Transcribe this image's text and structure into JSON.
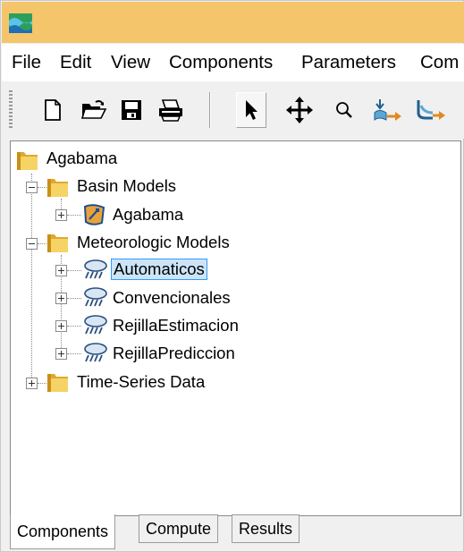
{
  "app": {
    "icon": "hec-hms-app-icon"
  },
  "menu": [
    "File",
    "Edit",
    "View",
    "Components",
    "Parameters",
    "Com"
  ],
  "toolbar": {
    "buttons": [
      {
        "icon": "new-file-icon"
      },
      {
        "icon": "open-folder-icon"
      },
      {
        "icon": "save-icon"
      },
      {
        "icon": "print-icon"
      },
      {
        "icon": "pointer-arrow-icon",
        "active": true
      },
      {
        "icon": "move-arrows-icon"
      },
      {
        "icon": "zoom-magnifier-icon"
      },
      {
        "icon": "add-subbasin-icon"
      },
      {
        "icon": "add-reach-icon"
      }
    ]
  },
  "tree": {
    "root": "Agabama",
    "basin_models": "Basin Models",
    "basin_child": "Agabama",
    "meteorologic_models": "Meteorologic Models",
    "met_children": [
      "Automaticos",
      "Convencionales",
      "RejillaEstimacion",
      "RejillaPrediccion"
    ],
    "selected": "Automaticos",
    "time_series": "Time-Series Data"
  },
  "tabs": [
    "Components",
    "Compute",
    "Results"
  ],
  "active_tab": "Components",
  "colors": {
    "titlebar": "#f4c56a",
    "folder": "#f2c94c",
    "selection": "#cce4f7",
    "selection_border": "#3399ff"
  }
}
